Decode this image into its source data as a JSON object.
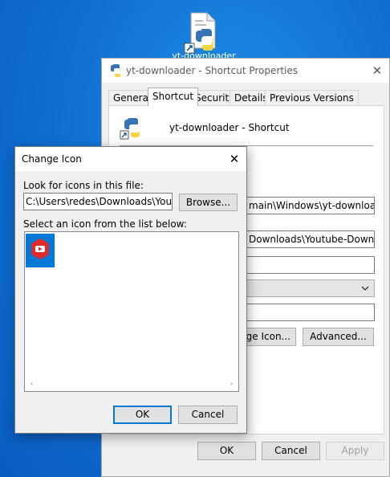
{
  "desktop": {
    "icon_label": "yt-downloader"
  },
  "properties_window": {
    "title": "yt-downloader - Shortcut Properties",
    "close_glyph": "✕",
    "tabs": [
      {
        "label": "General"
      },
      {
        "label": "Shortcut"
      },
      {
        "label": "Security"
      },
      {
        "label": "Details"
      },
      {
        "label": "Previous Versions"
      }
    ],
    "active_tab": "Shortcut",
    "shortcut_name": "yt-downloader - Shortcut",
    "target_value": "main\\Windows\\yt-downloader.py",
    "start_in_value": "Downloads\\Youtube-Downloader",
    "shortcut_key_value": "",
    "run_select_value": "",
    "comment_value": "",
    "change_icon_button": "nge Icon...",
    "advanced_button": "Advanced...",
    "ok_button": "OK",
    "cancel_button": "Cancel",
    "apply_button": "Apply"
  },
  "change_icon_dialog": {
    "title": "Change Icon",
    "close_glyph": "✕",
    "look_label": "Look for icons in this file:",
    "file_path": "C:\\Users\\redes\\Downloads\\Youtube-",
    "browse_button": "Browse...",
    "select_label": "Select an icon from the list below:",
    "icons": [
      {
        "name": "youtube-icon",
        "selected": true
      }
    ],
    "ok_button": "OK",
    "cancel_button": "Cancel"
  },
  "colors": {
    "desktop_blue": "#0f6dd1",
    "selection_blue": "#0078d7",
    "youtube_red": "#e02b2b"
  }
}
